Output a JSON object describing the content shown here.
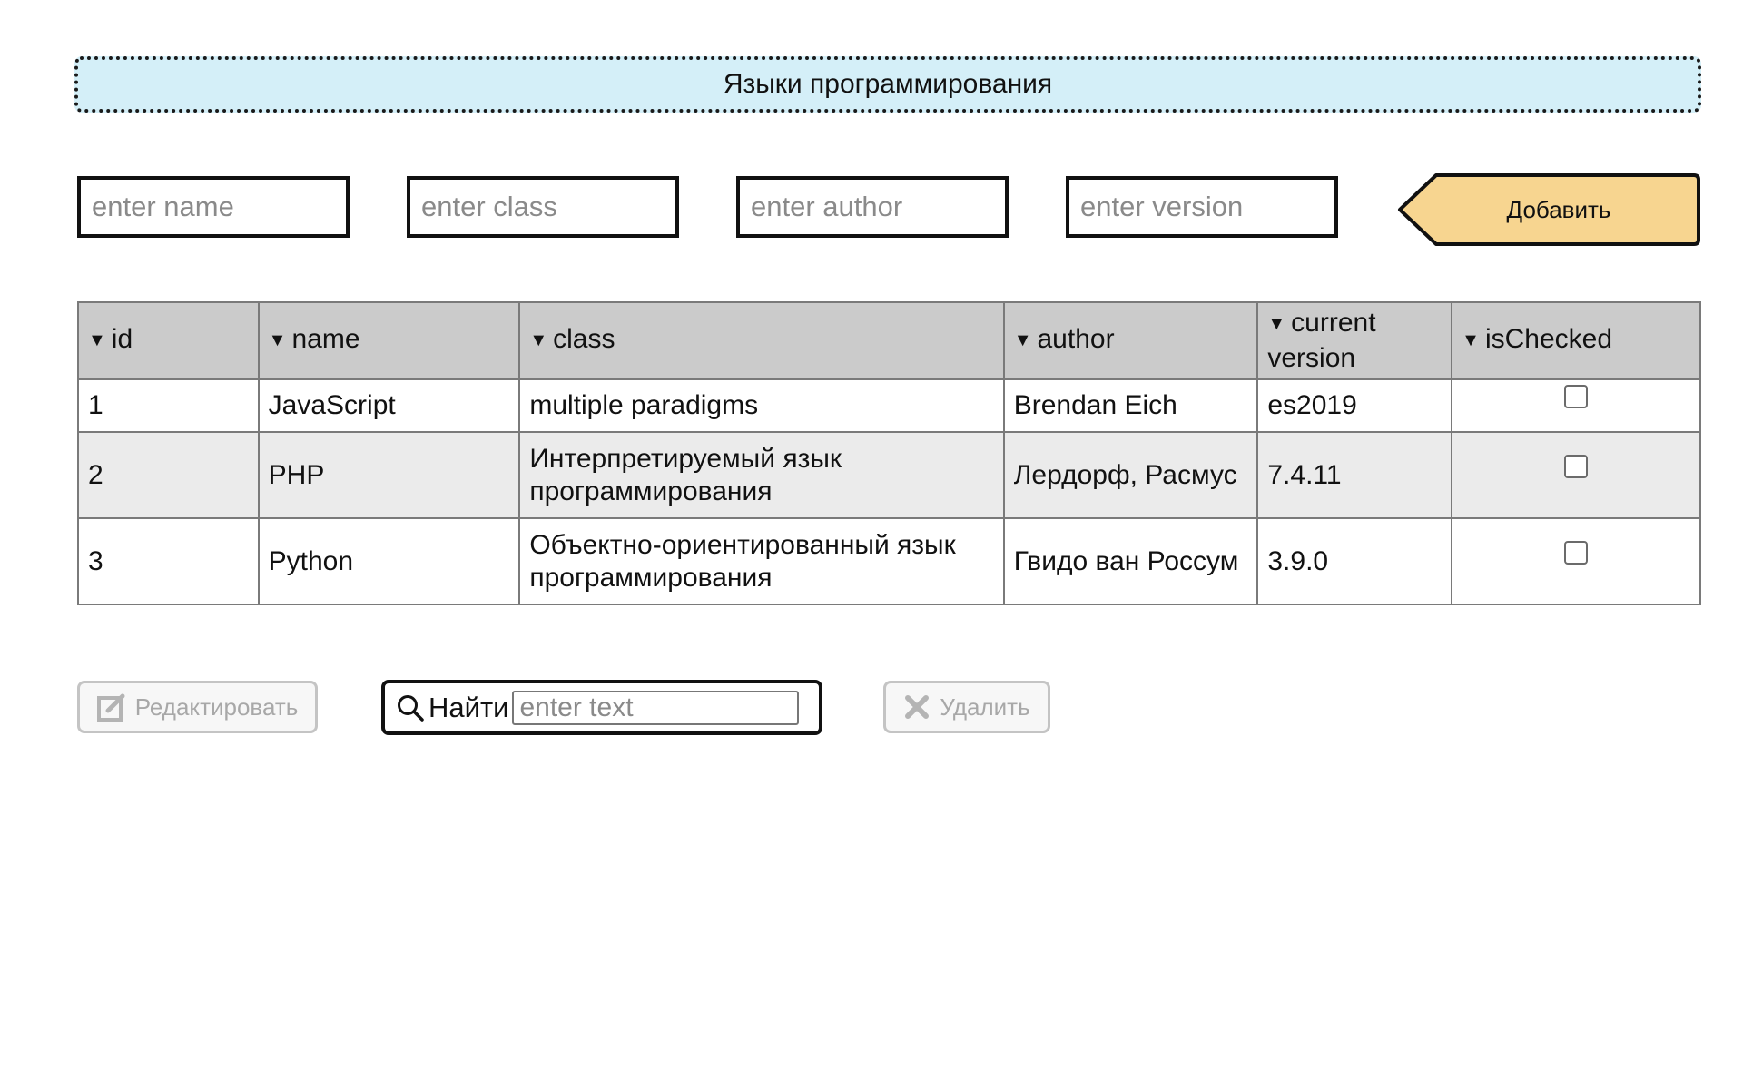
{
  "header": {
    "title": "Языки программирования"
  },
  "form": {
    "name_placeholder": "enter name",
    "class_placeholder": "enter class",
    "author_placeholder": "enter author",
    "version_placeholder": "enter version",
    "add_label": "Добавить"
  },
  "table": {
    "columns": [
      {
        "key": "id",
        "label": "id"
      },
      {
        "key": "name",
        "label": "name"
      },
      {
        "key": "class",
        "label": "class"
      },
      {
        "key": "author",
        "label": "author"
      },
      {
        "key": "version",
        "label": "current version"
      },
      {
        "key": "isChecked",
        "label": "isChecked"
      }
    ],
    "sort_indicator": "▼",
    "rows": [
      {
        "id": "1",
        "name": "JavaScript",
        "class": "multiple paradigms",
        "author": "Brendan Eich",
        "version": "es2019",
        "isChecked": false
      },
      {
        "id": "2",
        "name": "PHP",
        "class": "Интерпретируемый язык программирования",
        "author": "Лердорф, Расмус",
        "version": "7.4.11",
        "isChecked": false
      },
      {
        "id": "3",
        "name": "Python",
        "class": "Объектно-ориентированный язык программирования",
        "author": "Гвидо ван Россум",
        "version": "3.9.0",
        "isChecked": false
      }
    ]
  },
  "actions": {
    "edit_label": "Редактировать",
    "edit_icon": "edit-icon",
    "search_label": "Найти",
    "search_icon": "search-icon",
    "search_placeholder": "enter text",
    "delete_label": "Удалить",
    "delete_icon": "close-icon"
  },
  "colors": {
    "banner_bg": "#d4eff8",
    "add_button_bg": "#f7d590",
    "header_bg": "#cbcbcb",
    "row_alt_bg": "#ebebeb",
    "disabled_text": "#a8a8a8"
  }
}
